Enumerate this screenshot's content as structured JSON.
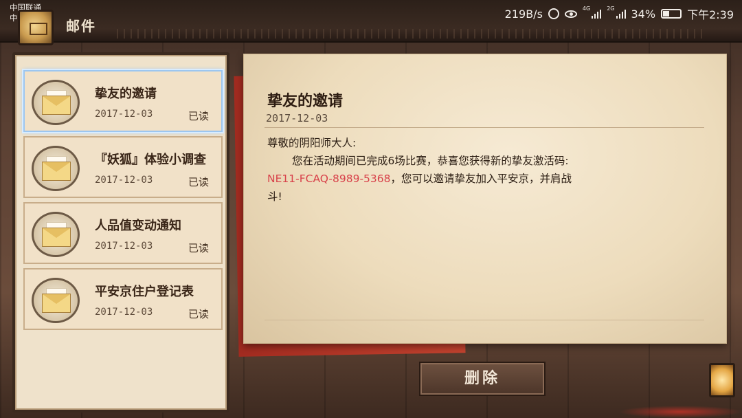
{
  "status_bar": {
    "carrier_1": "中国联通",
    "carrier_2": "中国移动",
    "net_speed": "219B/s",
    "signal_1_label": "4G",
    "signal_2_label": "2G",
    "battery": "34%",
    "time": "下午2:39"
  },
  "header": {
    "title": "邮件"
  },
  "mail_list": [
    {
      "subject": "挚友的邀请",
      "date": "2017-12-03",
      "status": "已读",
      "selected": true
    },
    {
      "subject": "『妖狐』体验小调查",
      "date": "2017-12-03",
      "status": "已读",
      "selected": false
    },
    {
      "subject": "人品值变动通知",
      "date": "2017-12-03",
      "status": "已读",
      "selected": false
    },
    {
      "subject": "平安京住户登记表",
      "date": "2017-12-03",
      "status": "已读",
      "selected": false
    }
  ],
  "letter": {
    "title": "挚友的邀请",
    "date": "2017-12-03",
    "greeting": "尊敬的阴阳师大人:",
    "line_1": "您在活动期间已完成6场比赛，恭喜您获得新的挚友激活码:",
    "code": "NE11-FCAQ-8989-5368",
    "line_2": "，您可以邀请挚友加入平安京，并肩战",
    "line_3": "斗!"
  },
  "actions": {
    "delete_label": "删除"
  },
  "colors": {
    "code": "#d8414a",
    "selection": "#9cc6f0"
  }
}
